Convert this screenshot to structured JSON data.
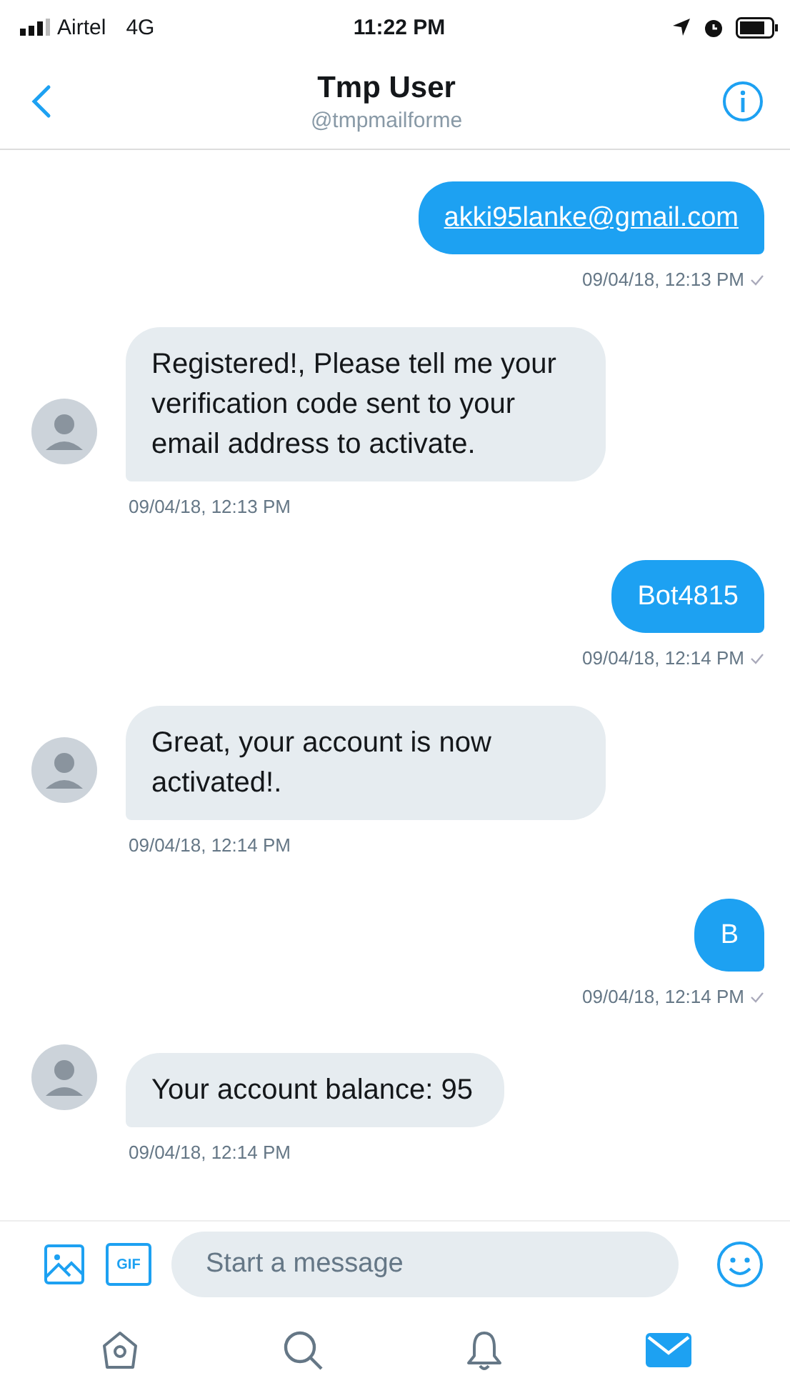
{
  "status_bar": {
    "carrier": "Airtel",
    "network": "4G",
    "time": "11:22 PM"
  },
  "header": {
    "title": "Tmp User",
    "handle": "@tmpmailforme"
  },
  "messages": [
    {
      "kind": "sent",
      "text": "akki95lanke@gmail.com",
      "link": true,
      "time": "09/04/18, 12:13 PM",
      "read": true
    },
    {
      "kind": "received",
      "text": "Registered!, Please tell me your verification code sent to your email address to activate.",
      "time": "09/04/18, 12:13 PM"
    },
    {
      "kind": "sent",
      "text": "Bot4815",
      "link": false,
      "time": "09/04/18, 12:14 PM",
      "read": true
    },
    {
      "kind": "received",
      "text": "Great, your account is now activated!.",
      "time": "09/04/18, 12:14 PM"
    },
    {
      "kind": "sent",
      "text": "B",
      "link": false,
      "time": "09/04/18, 12:14 PM",
      "read": true
    },
    {
      "kind": "received",
      "text": "Your account balance: 95",
      "time": "09/04/18, 12:14 PM"
    }
  ],
  "composer": {
    "gif_label": "GIF",
    "placeholder": "Start a message"
  },
  "tabs": [
    {
      "kind": "home",
      "selected": false
    },
    {
      "kind": "search",
      "selected": false
    },
    {
      "kind": "notifications",
      "selected": false
    },
    {
      "kind": "messages",
      "selected": true
    }
  ]
}
